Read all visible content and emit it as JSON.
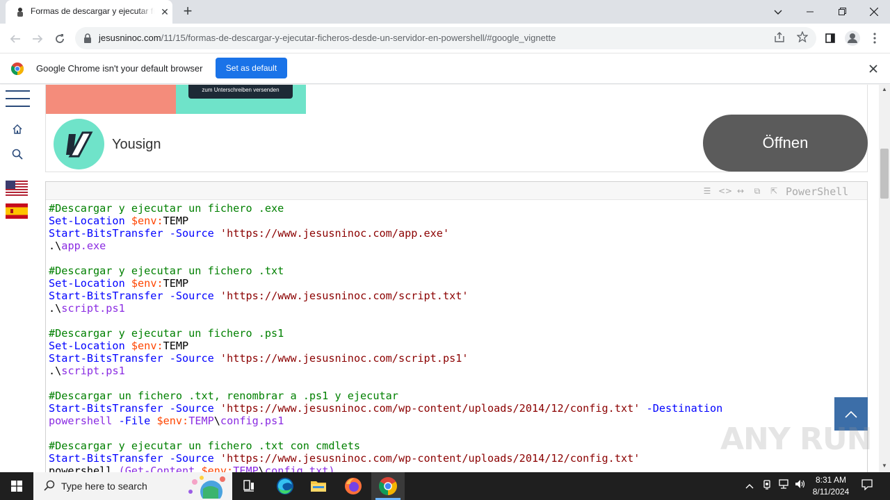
{
  "browser": {
    "tab_title": "Formas de descargar y ejecutar ficheros",
    "tab_close": "✕",
    "new_tab": "+",
    "url_host": "jesusninoc.com",
    "url_path": "/11/15/formas-de-descargar-y-ejecutar-ficheros-desde-un-servidor-en-powershell/#google_vignette"
  },
  "infobar": {
    "message": "Google Chrome isn't your default browser",
    "button": "Set as default"
  },
  "ad": {
    "image_button": "zum Unterschreiben versenden",
    "brand": "Yousign",
    "cta": "Öffnen"
  },
  "code": {
    "language": "PowerShell",
    "lines": [
      [
        [
          "c",
          "#Descargar y ejecutar un fichero .exe"
        ]
      ],
      [
        [
          "k",
          "Set-Location"
        ],
        [
          "n",
          " "
        ],
        [
          "v",
          "$env:"
        ],
        [
          "n",
          "TEMP"
        ]
      ],
      [
        [
          "k",
          "Start-BitsTransfer"
        ],
        [
          "n",
          " "
        ],
        [
          "k",
          "-Source"
        ],
        [
          "n",
          " "
        ],
        [
          "s",
          "'https://www.jesusninoc.com/app.exe'"
        ]
      ],
      [
        [
          "n",
          ".\\"
        ],
        [
          "p",
          "app.exe"
        ]
      ],
      [],
      [
        [
          "c",
          "#Descargar y ejecutar un fichero .txt"
        ]
      ],
      [
        [
          "k",
          "Set-Location"
        ],
        [
          "n",
          " "
        ],
        [
          "v",
          "$env:"
        ],
        [
          "n",
          "TEMP"
        ]
      ],
      [
        [
          "k",
          "Start-BitsTransfer"
        ],
        [
          "n",
          " "
        ],
        [
          "k",
          "-Source"
        ],
        [
          "n",
          " "
        ],
        [
          "s",
          "'https://www.jesusninoc.com/script.txt'"
        ]
      ],
      [
        [
          "n",
          ".\\"
        ],
        [
          "p",
          "script.ps1"
        ]
      ],
      [],
      [
        [
          "c",
          "#Descargar y ejecutar un fichero .ps1"
        ]
      ],
      [
        [
          "k",
          "Set-Location"
        ],
        [
          "n",
          " "
        ],
        [
          "v",
          "$env:"
        ],
        [
          "n",
          "TEMP"
        ]
      ],
      [
        [
          "k",
          "Start-BitsTransfer"
        ],
        [
          "n",
          " "
        ],
        [
          "k",
          "-Source"
        ],
        [
          "n",
          " "
        ],
        [
          "s",
          "'https://www.jesusninoc.com/script.ps1'"
        ]
      ],
      [
        [
          "n",
          ".\\"
        ],
        [
          "p",
          "script.ps1"
        ]
      ],
      [],
      [
        [
          "c",
          "#Descargar un fichero .txt, renombrar a .ps1 y ejecutar"
        ]
      ],
      [
        [
          "k",
          "Start-BitsTransfer"
        ],
        [
          "n",
          " "
        ],
        [
          "k",
          "-Source"
        ],
        [
          "n",
          " "
        ],
        [
          "s",
          "'https://www.jesusninoc.com/wp-content/uploads/2014/12/config.txt'"
        ],
        [
          "n",
          " "
        ],
        [
          "k",
          "-Destination"
        ]
      ],
      [
        [
          "p",
          "powershell"
        ],
        [
          "n",
          " "
        ],
        [
          "k",
          "-File"
        ],
        [
          "n",
          " "
        ],
        [
          "v",
          "$env:"
        ],
        [
          "p",
          "TEMP"
        ],
        [
          "n",
          "\\"
        ],
        [
          "p",
          "config.ps1"
        ]
      ],
      [],
      [
        [
          "c",
          "#Descargar y ejecutar un fichero .txt con cmdlets"
        ]
      ],
      [
        [
          "k",
          "Start-BitsTransfer"
        ],
        [
          "n",
          " "
        ],
        [
          "k",
          "-Source"
        ],
        [
          "n",
          " "
        ],
        [
          "s",
          "'https://www.jesusninoc.com/wp-content/uploads/2014/12/config.txt'"
        ]
      ],
      [
        [
          "n",
          "powershell "
        ],
        [
          "p",
          "(Get-Content "
        ],
        [
          "v",
          "$env:"
        ],
        [
          "p",
          "TEMP"
        ],
        [
          "n",
          "\\"
        ],
        [
          "p",
          "config.txt)"
        ]
      ]
    ]
  },
  "watermark": "ANY RUN",
  "taskbar": {
    "search_placeholder": "Type here to search",
    "time": "8:31 AM",
    "date": "8/11/2024"
  },
  "colors": {
    "accent": "#1a73e8",
    "comment": "#008000",
    "keyword": "#0000ff",
    "variable": "#ff4500",
    "string": "#8b0000",
    "path": "#8a2be2"
  },
  "icons": {
    "back": "back-arrow-icon",
    "forward": "forward-arrow-icon",
    "reload": "reload-icon",
    "lock": "lock-icon",
    "share": "share-icon",
    "star": "star-icon",
    "sidepanel": "side-panel-icon",
    "profile": "profile-icon",
    "menu": "kebab-menu-icon"
  }
}
